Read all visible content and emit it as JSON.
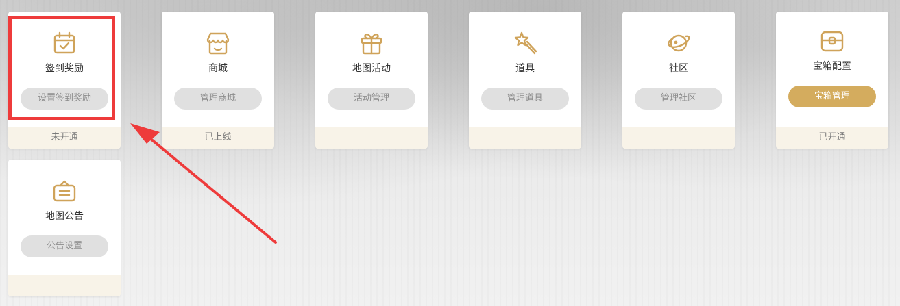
{
  "cards": [
    {
      "title": "签到奖励",
      "button": "设置签到奖励",
      "status": "未开通",
      "icon": "calendar-check-icon"
    },
    {
      "title": "商城",
      "button": "管理商城",
      "status": "已上线",
      "icon": "shop-icon"
    },
    {
      "title": "地图活动",
      "button": "活动管理",
      "status": "",
      "icon": "gift-icon"
    },
    {
      "title": "道具",
      "button": "管理道具",
      "status": "",
      "icon": "magic-wand-icon"
    },
    {
      "title": "社区",
      "button": "管理社区",
      "status": "",
      "icon": "planet-icon"
    },
    {
      "title": "宝箱配置",
      "button": "宝箱管理",
      "status": "已开通",
      "icon": "treasure-chest-icon"
    },
    {
      "title": "地图公告",
      "button": "公告设置",
      "status": "",
      "icon": "announcement-board-icon"
    }
  ],
  "colors": {
    "accent": "#d4ac5e",
    "icon": "#cfa35a",
    "disabled_button": "#e0e0e0",
    "footer": "#f8f3e8",
    "annotation": "#ee3b3b"
  }
}
